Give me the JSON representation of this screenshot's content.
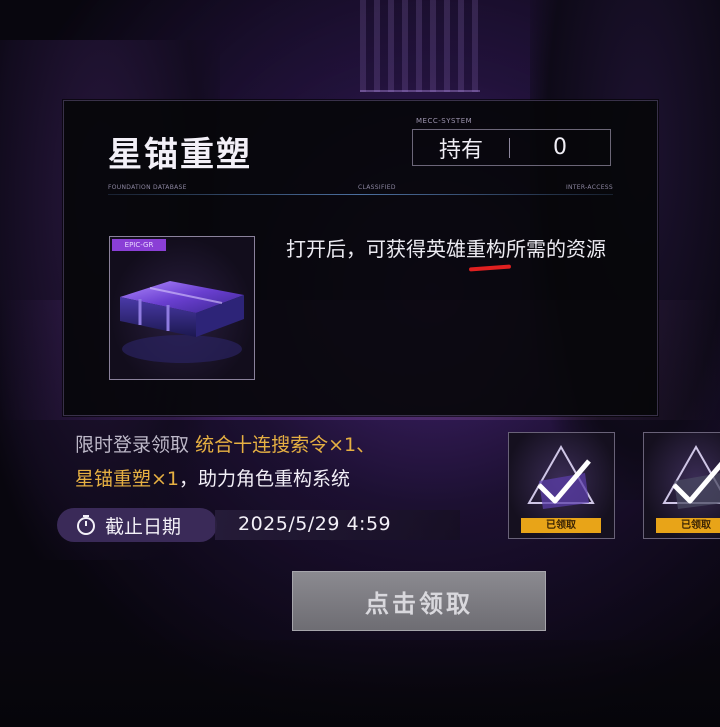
{
  "panel": {
    "title": "星锚重塑",
    "system_label": "MECC-SYSTEM",
    "hold_label": "持有",
    "hold_value": "0",
    "meta_left": "FOUNDATION DATABASE",
    "meta_mid": "CLASSIFIED",
    "meta_right": "INTER-ACCESS",
    "item_rarity": "EPIC-GR",
    "description": "打开后，可获得英雄重构所需的资源"
  },
  "event": {
    "prefix": "限时登录领取",
    "reward1": "统合十连搜索令×1、",
    "reward2": "星锚重塑×1",
    "suffix": "，助力角色重构系统",
    "deadline_label": "截止日期",
    "deadline_value": "2025/5/29 4:59"
  },
  "rewards": [
    {
      "status": "已领取"
    },
    {
      "status": "已领取"
    }
  ],
  "claim_button": "点击领取",
  "colors": {
    "highlight": "#e6b042",
    "claimed_tag": "#e8a418",
    "pill": "#3a2a58",
    "annotation": "#e02020"
  },
  "icons": [
    "timer-icon",
    "checkmark-icon",
    "item-box-icon"
  ]
}
